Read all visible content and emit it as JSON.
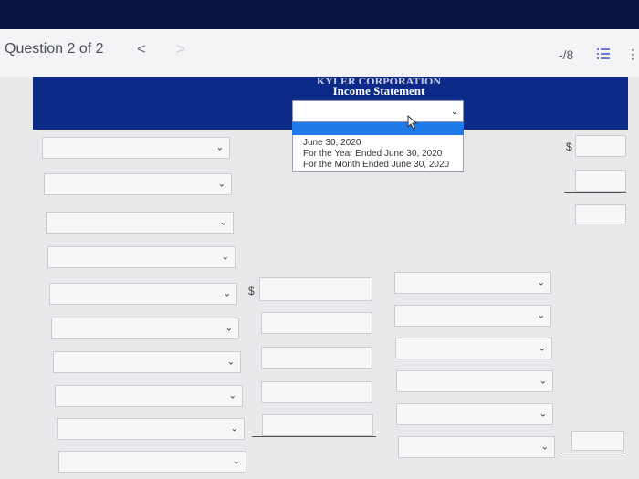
{
  "question": {
    "label": "Question 2 of 2",
    "prev": "<",
    "next": ">",
    "score": "-/8"
  },
  "statement": {
    "company": "KYLER CORPORATION",
    "title": "Income Statement"
  },
  "period_dropdown": {
    "options": [
      "June 30, 2020",
      "For the Year Ended June 30, 2020",
      "For the Month Ended June 30, 2020"
    ]
  },
  "currency": "$",
  "colors": {
    "header": "#0c2a88",
    "topband": "#0b1340",
    "highlight": "#1f7ae8"
  }
}
